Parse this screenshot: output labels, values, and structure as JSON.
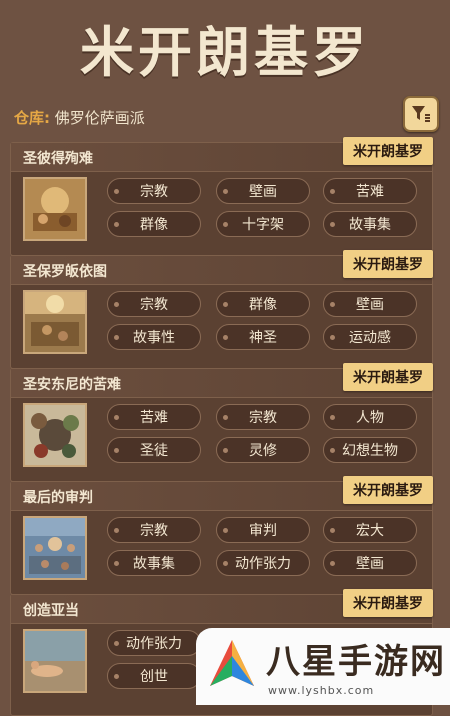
{
  "title": "米开朗基罗",
  "warehouse": {
    "label": "仓库:",
    "value": "佛罗伦萨画派"
  },
  "filter": {
    "icon": "filter-icon"
  },
  "cards": [
    {
      "name": "圣彼得殉难",
      "artist": "米开朗基罗",
      "tags": [
        "宗教",
        "壁画",
        "苦难",
        "群像",
        "十字架",
        "故事集"
      ]
    },
    {
      "name": "圣保罗皈依图",
      "artist": "米开朗基罗",
      "tags": [
        "宗教",
        "群像",
        "壁画",
        "故事性",
        "神圣",
        "运动感"
      ]
    },
    {
      "name": "圣安东尼的苦难",
      "artist": "米开朗基罗",
      "tags": [
        "苦难",
        "宗教",
        "人物",
        "圣徒",
        "灵修",
        "幻想生物"
      ]
    },
    {
      "name": "最后的审判",
      "artist": "米开朗基罗",
      "tags": [
        "宗教",
        "审判",
        "宏大",
        "故事集",
        "动作张力",
        "壁画"
      ]
    },
    {
      "name": "创造亚当",
      "artist": "米开朗基罗",
      "tags": [
        "动作张力",
        "创世"
      ]
    }
  ],
  "watermark": {
    "text": "八星手游网",
    "url": "www.lyshbx.com"
  }
}
